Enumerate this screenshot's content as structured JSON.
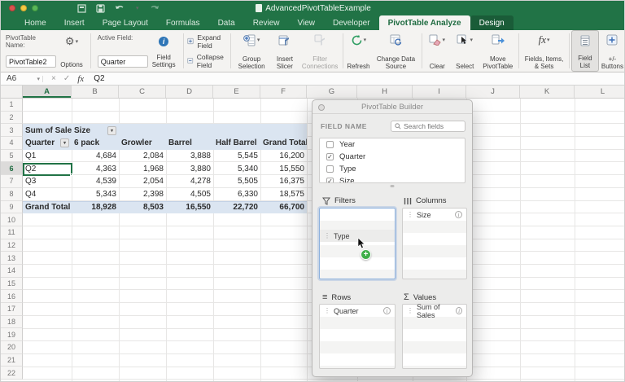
{
  "app": {
    "title": "AdvancedPivotTableExample"
  },
  "ribbon_tabs": [
    {
      "label": "Home",
      "state": "normal"
    },
    {
      "label": "Insert",
      "state": "normal"
    },
    {
      "label": "Page Layout",
      "state": "normal"
    },
    {
      "label": "Formulas",
      "state": "normal"
    },
    {
      "label": "Data",
      "state": "normal"
    },
    {
      "label": "Review",
      "state": "normal"
    },
    {
      "label": "View",
      "state": "normal"
    },
    {
      "label": "Developer",
      "state": "normal"
    },
    {
      "label": "PivotTable Analyze",
      "state": "active"
    },
    {
      "label": "Design",
      "state": "design"
    }
  ],
  "ribbon": {
    "pivottable_name_label": "PivotTable Name:",
    "pivottable_name_value": "PivotTable2",
    "options": "Options",
    "active_field_label": "Active Field:",
    "active_field_value": "Quarter",
    "field_settings": "Field Settings",
    "expand_field": "Expand Field",
    "collapse_field": "Collapse Field",
    "group_selection": "Group Selection",
    "insert_slicer": "Insert Slicer",
    "filter_connections": "Filter Connections",
    "refresh": "Refresh",
    "change_data_source": "Change Data Source",
    "clear": "Clear",
    "select": "Select",
    "move_pivottable": "Move PivotTable",
    "fields_items_sets": "Fields, Items, & Sets",
    "field_list": "Field List",
    "plus_minus_buttons": "+/- Buttons"
  },
  "formula_bar": {
    "cell_ref": "A6",
    "cancel_glyph": "×",
    "enter_glyph": "✓",
    "fx_glyph": "fx",
    "content": "Q2"
  },
  "sheet": {
    "columns": [
      "A",
      "B",
      "C",
      "D",
      "E",
      "F",
      "G",
      "H",
      "I",
      "J",
      "K",
      "L"
    ],
    "rows": [
      "1",
      "2",
      "3",
      "4",
      "5",
      "6",
      "7",
      "8",
      "9",
      "10",
      "11",
      "12",
      "13",
      "14",
      "15",
      "16",
      "17",
      "18",
      "19",
      "20",
      "21",
      "22"
    ],
    "selected_column": "A",
    "selected_row": "6"
  },
  "pivot": {
    "corner_label": "Sum of Sales",
    "col_field": "Size",
    "row_field": "Quarter",
    "col_headers": [
      "6 pack",
      "Growler",
      "Barrel",
      "Half Barrel",
      "Grand Total"
    ],
    "rows": [
      {
        "label": "Q1",
        "values": [
          "4,684",
          "2,084",
          "3,888",
          "5,545",
          "16,200"
        ]
      },
      {
        "label": "Q2",
        "values": [
          "4,363",
          "1,968",
          "3,880",
          "5,340",
          "15,550"
        ]
      },
      {
        "label": "Q3",
        "values": [
          "4,539",
          "2,054",
          "4,278",
          "5,505",
          "16,375"
        ]
      },
      {
        "label": "Q4",
        "values": [
          "5,343",
          "2,398",
          "4,505",
          "6,330",
          "18,575"
        ]
      }
    ],
    "total_row": {
      "label": "Grand Total",
      "values": [
        "18,928",
        "8,503",
        "16,550",
        "22,720",
        "66,700"
      ]
    }
  },
  "builder": {
    "title": "PivotTable Builder",
    "field_name_label": "FIELD NAME",
    "search_placeholder": "Search fields",
    "fields": [
      {
        "name": "Year",
        "checked": false
      },
      {
        "name": "Quarter",
        "checked": true
      },
      {
        "name": "Type",
        "checked": false
      },
      {
        "name": "Size",
        "checked": true
      }
    ],
    "areas": {
      "filters": {
        "label": "Filters",
        "items": [
          "Type"
        ]
      },
      "columns": {
        "label": "Columns",
        "items": [
          "Size"
        ]
      },
      "rows": {
        "label": "Rows",
        "items": [
          "Quarter"
        ]
      },
      "values": {
        "label": "Values",
        "items": [
          "Sum of Sales"
        ]
      }
    }
  },
  "icons": {
    "dropdown": "▾",
    "check": "✓",
    "dots": "⋮",
    "sigma": "Σ",
    "rows_glyph": "≡",
    "info": "i"
  },
  "colors": {
    "excel_green": "#217346",
    "pivot_header_blue": "#dbe5f1",
    "selection_green": "#217346",
    "drag_plus_green": "#3fae49",
    "ribbon_bg": "#f4f3f1"
  }
}
